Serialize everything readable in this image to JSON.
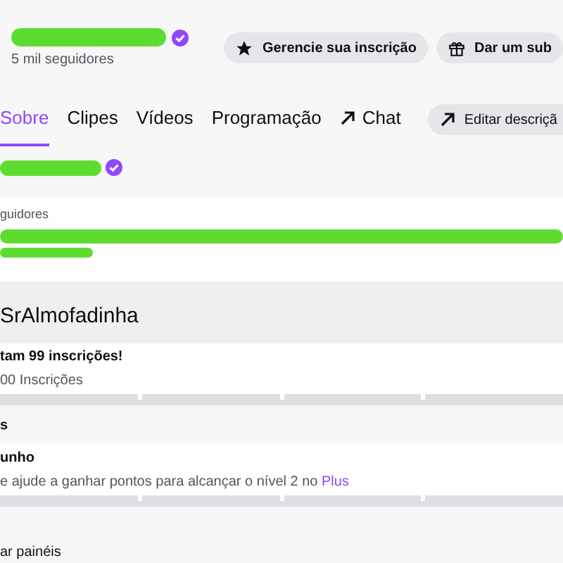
{
  "header": {
    "followers": "5 mil seguidores",
    "buttons": [
      {
        "kind": "star",
        "label": "Gerencie sua inscrição"
      },
      {
        "kind": "gift",
        "label": "Dar um sub"
      }
    ]
  },
  "tabs": [
    {
      "label": "Sobre",
      "selected": true,
      "external": false
    },
    {
      "label": "Clipes",
      "selected": false,
      "external": false
    },
    {
      "label": "Vídeos",
      "selected": false,
      "external": false
    },
    {
      "label": "Programação",
      "selected": false,
      "external": false
    },
    {
      "label": "Chat",
      "selected": false,
      "external": true
    }
  ],
  "edit_button": "Editar descriçã",
  "about": {
    "followers_label": "guidores"
  },
  "goals_title": "SrAlmofadinha",
  "goal": {
    "title": "tam 99 inscrições!",
    "subtitle": "00 Inscrições"
  },
  "section_label": "s",
  "goal2": {
    "title": "unho",
    "text": "e ajude a ganhar pontos para alcançar o nível 2 no",
    "link": "Plus"
  },
  "panels_label": "ar painéis"
}
